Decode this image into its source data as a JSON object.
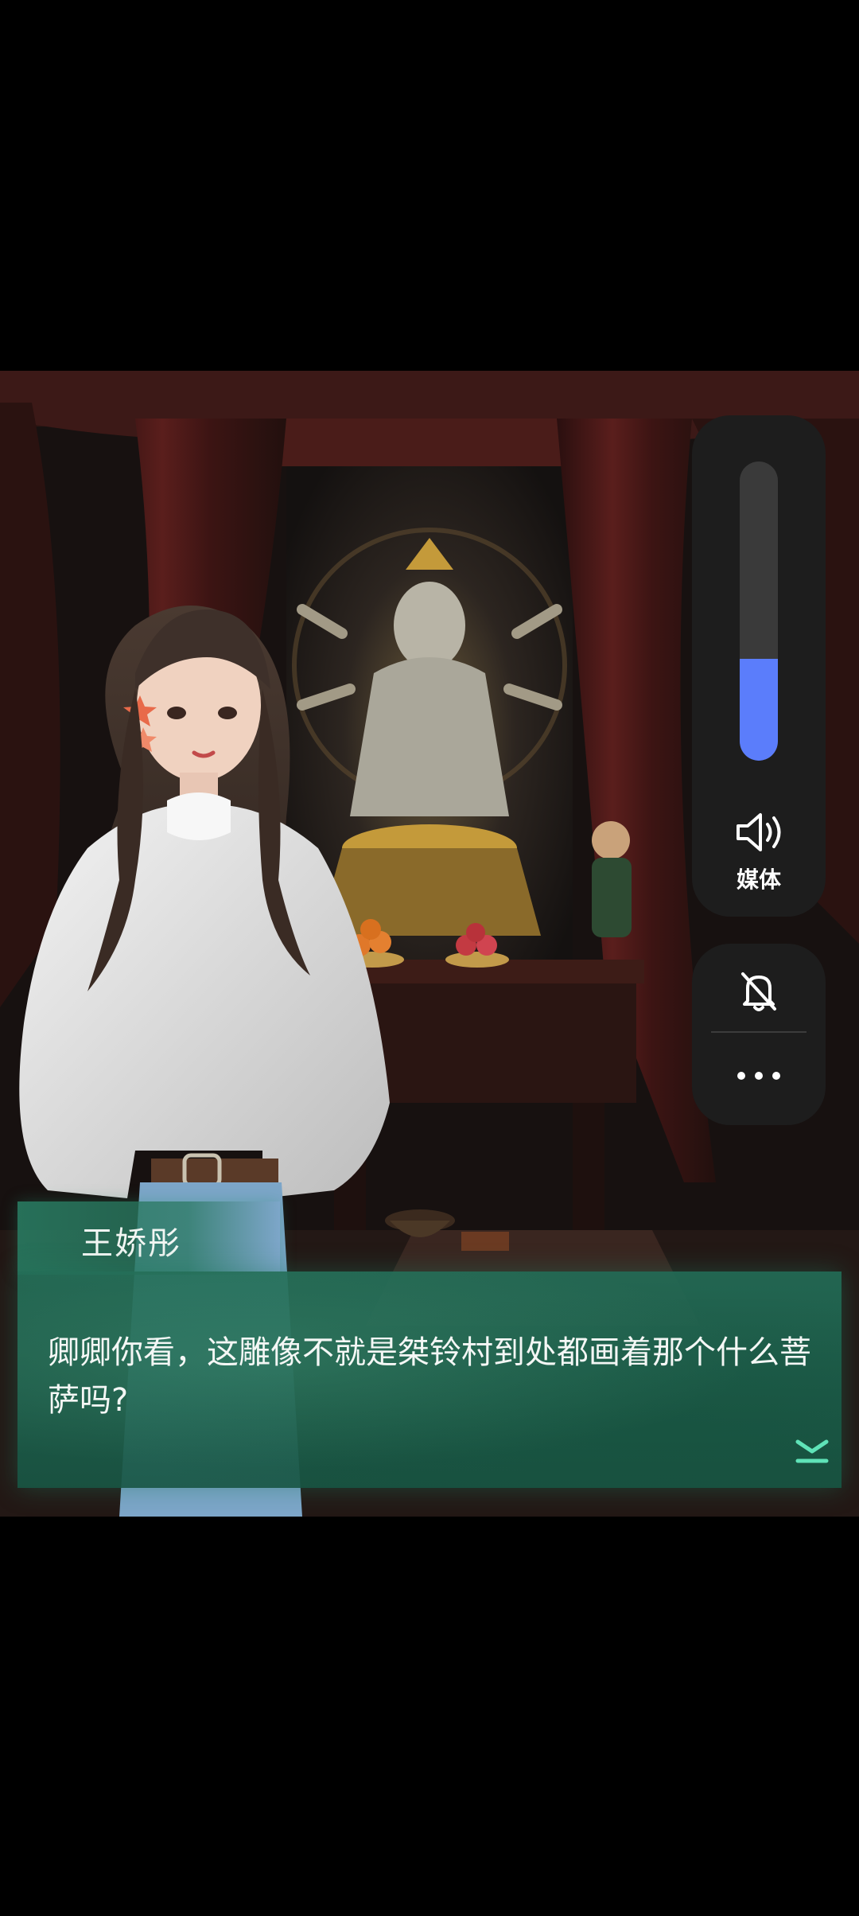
{
  "game": {
    "speaker_name": "王娇彤",
    "dialogue_text": "卿卿你看，这雕像不就是桀铃村到处都画着那个什么菩萨吗?",
    "advance_icon": "double-chevron-down-icon"
  },
  "volume_panel": {
    "level": 0.34,
    "label": "媒体",
    "icon": "speaker-icon",
    "accent_color": "#5b7dfb"
  },
  "ringer_panel": {
    "mute_icon": "bell-off-icon",
    "more_icon": "more-icon"
  }
}
